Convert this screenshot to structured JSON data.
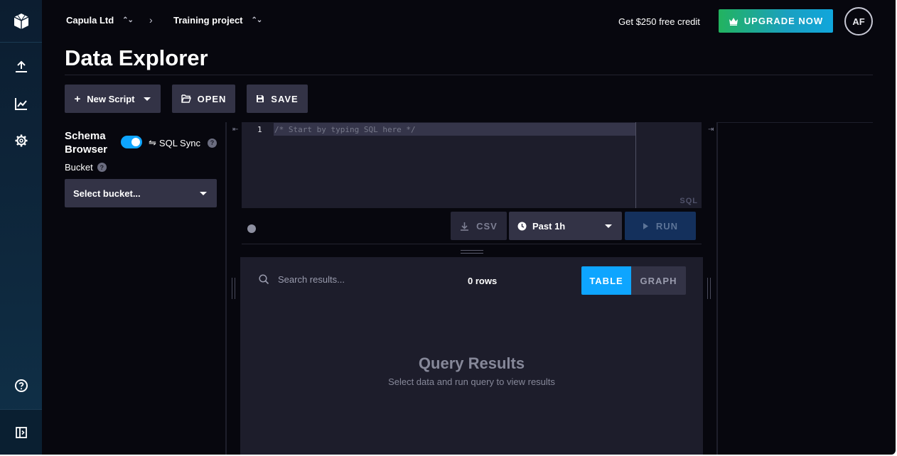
{
  "nav": {
    "items": [
      {
        "name": "upload-icon"
      },
      {
        "name": "chart-icon"
      },
      {
        "name": "settings-icon"
      },
      {
        "name": "help-icon"
      },
      {
        "name": "collapse-sidebar-icon"
      }
    ]
  },
  "header": {
    "org": "Capula Ltd",
    "project": "Training project",
    "credit": "Get $250 free credit",
    "upgrade_label": "UPGRADE NOW",
    "avatar": "AF"
  },
  "page": {
    "title": "Data Explorer"
  },
  "toolbar": {
    "new_script": "New Script",
    "open": "OPEN",
    "save": "SAVE"
  },
  "schema": {
    "title": "Schema Browser",
    "sql_sync": "SQL Sync",
    "sql_sync_on": true,
    "bucket_label": "Bucket",
    "bucket_placeholder": "Select bucket..."
  },
  "editor": {
    "line_number": "1",
    "placeholder": "/* Start by typing SQL here */",
    "language": "SQL"
  },
  "runbar": {
    "csv": "CSV",
    "time_range": "Past 1h",
    "run": "RUN"
  },
  "results": {
    "search_placeholder": "Search results...",
    "row_count": "0 rows",
    "view_table": "TABLE",
    "view_graph": "GRAPH",
    "active_view": "TABLE",
    "empty_title": "Query Results",
    "empty_subtitle": "Select data and run query to view results"
  },
  "colors": {
    "accent": "#0ea5ff",
    "upgrade_gradient_start": "#22b35f",
    "upgrade_gradient_end": "#10a6dc",
    "run_button": "#14305c",
    "background": "#07070e",
    "panel": "#1d1d2b"
  }
}
